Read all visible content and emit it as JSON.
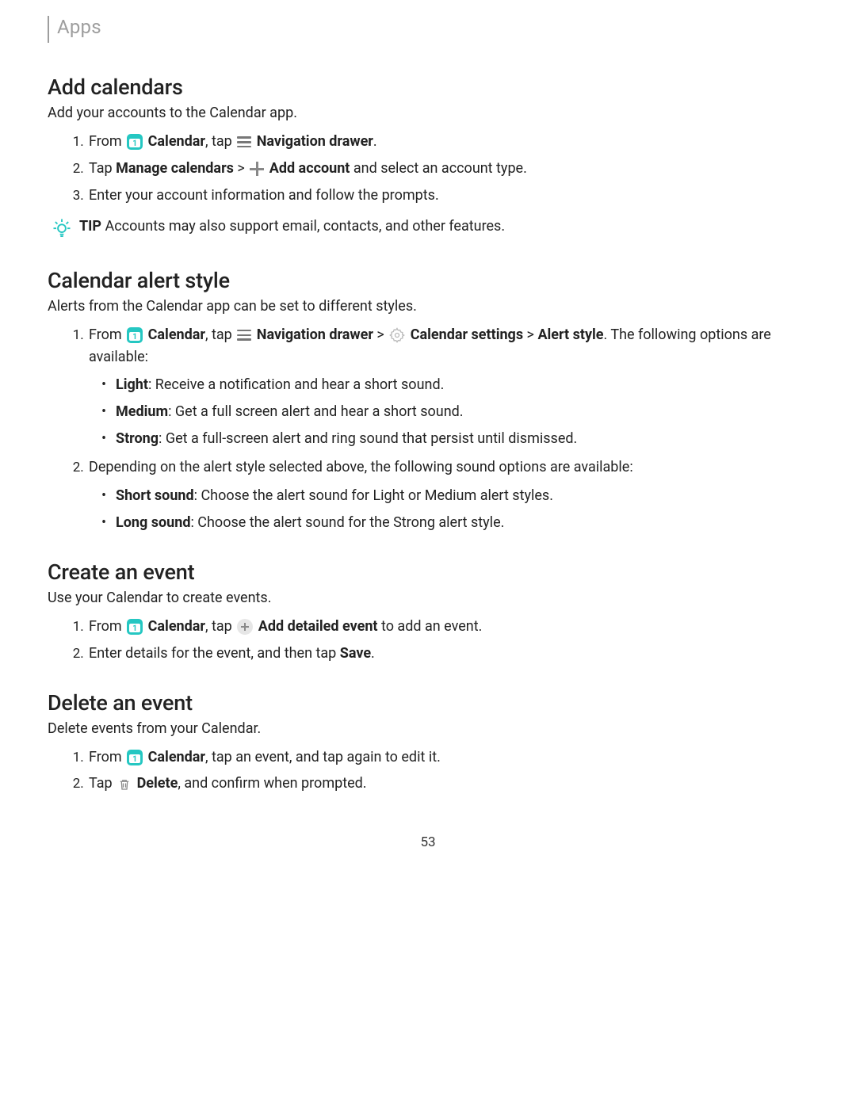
{
  "header": {
    "title": "Apps"
  },
  "section1": {
    "heading": "Add calendars",
    "intro": "Add your accounts to the Calendar app.",
    "step1_a": "From ",
    "step1_cal": " Calendar",
    "step1_b": ", tap ",
    "step1_nav": " Navigation drawer",
    "step1_c": ".",
    "step2_a": "Tap ",
    "step2_mc": "Manage calendars",
    "step2_b": " > ",
    "step2_add": " Add account",
    "step2_c": " and select an account type.",
    "step3": "Enter your account information and follow the prompts.",
    "tip_label": "TIP",
    "tip_text": "  Accounts may also support email, contacts, and other features."
  },
  "section2": {
    "heading": "Calendar alert style",
    "intro": "Alerts from the Calendar app can be set to different styles.",
    "step1_a": "From ",
    "step1_cal": " Calendar",
    "step1_b": ", tap ",
    "step1_nav": " Navigation drawer",
    "step1_c": " > ",
    "step1_cs": " Calendar settings",
    "step1_d": " > ",
    "step1_as": "Alert style",
    "step1_e": ". The following options are available:",
    "opt_light_b": "Light",
    "opt_light_t": ": Receive a notification and hear a short sound.",
    "opt_med_b": "Medium",
    "opt_med_t": ": Get a full screen alert and hear a short sound.",
    "opt_strong_b": "Strong",
    "opt_strong_t": ": Get a full-screen alert and ring sound that persist until dismissed.",
    "step2": "Depending on the alert style selected above, the following sound options are available:",
    "opt_ss_b": "Short sound",
    "opt_ss_t": ": Choose the alert sound for Light or Medium alert styles.",
    "opt_ls_b": "Long sound",
    "opt_ls_t": ": Choose the alert sound for the Strong alert style."
  },
  "section3": {
    "heading": "Create an event",
    "intro": "Use your Calendar to create events.",
    "step1_a": "From ",
    "step1_cal": " Calendar",
    "step1_b": ", tap ",
    "step1_add": " Add detailed event",
    "step1_c": " to add an event.",
    "step2_a": "Enter details for the event, and then tap ",
    "step2_save": "Save",
    "step2_b": "."
  },
  "section4": {
    "heading": "Delete an event",
    "intro": "Delete events from your Calendar.",
    "step1_a": "From ",
    "step1_cal": " Calendar",
    "step1_b": ", tap an event, and tap again to edit it.",
    "step2_a": "Tap ",
    "step2_del": " Delete",
    "step2_b": ", and confirm when prompted."
  },
  "footer": {
    "page_number": "53"
  }
}
